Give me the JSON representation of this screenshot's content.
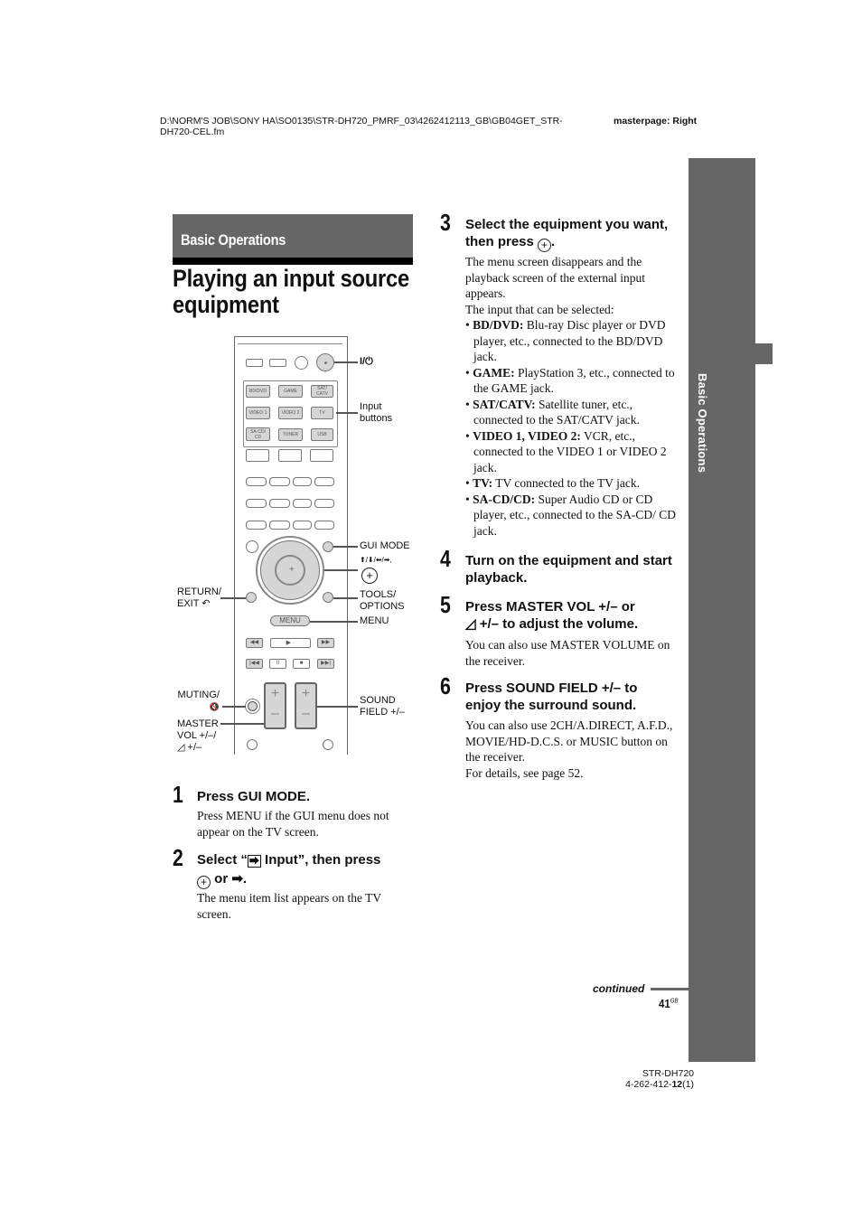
{
  "header": {
    "file_path_line1": "D:\\NORM'S JOB\\SONY HA\\SO0135\\STR-DH720_PMRF_03\\4262412113_GB\\GB04GET_STR-",
    "file_path_line2": "DH720-CEL.fm",
    "masterpage": "masterpage: Right"
  },
  "section": {
    "band_title": "Basic Operations",
    "page_title_line1": "Playing an input source",
    "page_title_line2": "equipment"
  },
  "remote": {
    "input_buttons": [
      "BD/DVD",
      "GAME",
      "SAT/ CATV",
      "VIDEO 1",
      "VIDEO 2",
      "TV",
      "SA-CD/ CD",
      "TUNER",
      "USB"
    ],
    "menu_button": "MENU",
    "callouts": {
      "power": "I/⏻",
      "input_buttons_1": "Input",
      "input_buttons_2": "buttons",
      "gui_mode": "GUI MODE",
      "arrows": "⬆/⬇/⬅/➡,",
      "return_1": "RETURN/",
      "return_2": "EXIT ↶",
      "tools_1": "TOOLS/",
      "tools_2": "OPTIONS",
      "menu": "MENU",
      "muting_1": "MUTING/",
      "muting_2": "🔇",
      "master_1": "MASTER",
      "master_2": "VOL +/–/",
      "master_3": "◿ +/–",
      "sound_1": "SOUND",
      "sound_2": "FIELD +/–"
    }
  },
  "steps": [
    {
      "num": "1",
      "head": "Press GUI MODE.",
      "body": "Press MENU if the GUI menu does not appear on the TV screen."
    },
    {
      "num": "2",
      "head_a": "Select “",
      "head_icon": "⮕",
      "head_b": " Input”, then press",
      "head_c": " or ➡.",
      "body": "The menu item list appears on the TV screen."
    },
    {
      "num": "3",
      "head_a": "Select the equipment you want,",
      "head_b": "then press",
      "head_c": ".",
      "body": "The menu screen disappears and the playback screen of the external input appears.",
      "body2": "The input that can be selected:",
      "bullets": [
        {
          "term": "BD/DVD:",
          "desc": " Blu-ray Disc player or DVD player, etc., connected to the BD/DVD jack."
        },
        {
          "term": "GAME:",
          "desc": " PlayStation 3, etc., connected to the GAME jack."
        },
        {
          "term": "SAT/CATV:",
          "desc": " Satellite tuner, etc., connected to the SAT/CATV jack."
        },
        {
          "term": "VIDEO 1, VIDEO 2:",
          "desc": " VCR, etc., connected to the VIDEO 1 or VIDEO 2 jack."
        },
        {
          "term": "TV:",
          "desc": " TV connected to the TV jack."
        },
        {
          "term": "SA-CD/CD:",
          "desc": " Super Audio CD or CD player, etc., connected to the SA-CD/ CD jack."
        }
      ]
    },
    {
      "num": "4",
      "head": "Turn on the equipment and start playback."
    },
    {
      "num": "5",
      "head_a": "Press MASTER VOL +/– or",
      "head_b": "◿ +/– to adjust the volume.",
      "body": "You can also use MASTER VOLUME on the receiver."
    },
    {
      "num": "6",
      "head": "Press SOUND FIELD +/– to enjoy the surround sound.",
      "body": "You can also use 2CH/A.DIRECT, A.F.D., MOVIE/HD-D.C.S. or MUSIC button on the receiver.",
      "body2": "For details, see page 52."
    }
  ],
  "sidebar": {
    "label": "Basic Operations"
  },
  "footer": {
    "continued": "continued",
    "page_number": "41",
    "page_suffix": "GB",
    "model": "STR-DH720",
    "part_prefix": "4-262-412-",
    "part_bold": "12",
    "part_suffix": "(1)"
  }
}
